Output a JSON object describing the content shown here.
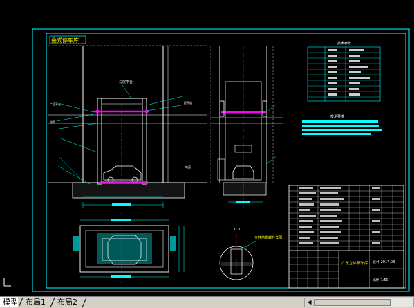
{
  "drawing": {
    "front_view_title": "叠式停车库",
    "front_view_label": "二层平台",
    "spec_table_title": "技术参数",
    "notes_title": "技术要求",
    "title_block_name": "广东立体停车库",
    "title_block_rows": [
      "设计 2017.03",
      "比例 1:50"
    ],
    "plan_note": "支柱地脚螺栓详图",
    "dim_label_1": "1:10"
  },
  "layout_tabs": [
    {
      "label": "模型",
      "active": true
    },
    {
      "label": "布局1",
      "active": false
    },
    {
      "label": "布局2",
      "active": false
    }
  ],
  "colors": {
    "background": "#000000",
    "border": "#00ffff",
    "structure": "#ffffff",
    "accent": "#ff00ff",
    "lines": "#00ffff"
  }
}
